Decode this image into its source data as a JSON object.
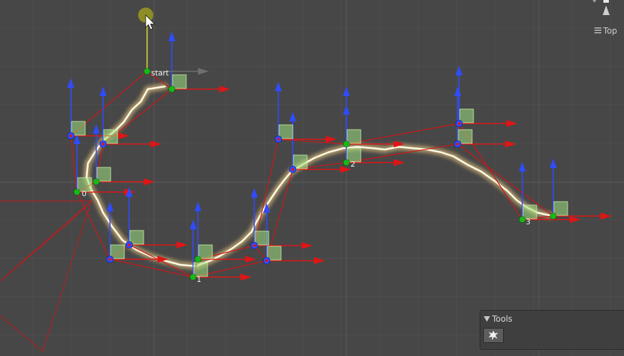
{
  "scene": {
    "start_label": "start",
    "point_labels": [
      "0",
      "1",
      "2",
      "3"
    ]
  },
  "view": {
    "mode_label": "Top",
    "menu_icon": "hamburger-icon",
    "gizmo_icon": "orientation-cone-icon"
  },
  "tools_panel": {
    "title": "Tools",
    "collapse_icon": "triangle-down-icon",
    "tool_icon": "lightning-tool-icon"
  },
  "colors": {
    "background": "#474747",
    "grid": "#555555",
    "grid_major": "#5e5e5e",
    "up_arrow": "#2f4cff",
    "right_arrow": "#e01515",
    "point": "#18b818",
    "handle_square": "#9fe07f",
    "selection": "#e0e030",
    "lightning_core": "#fffbe8",
    "lightning_glow": "#d9b978"
  }
}
